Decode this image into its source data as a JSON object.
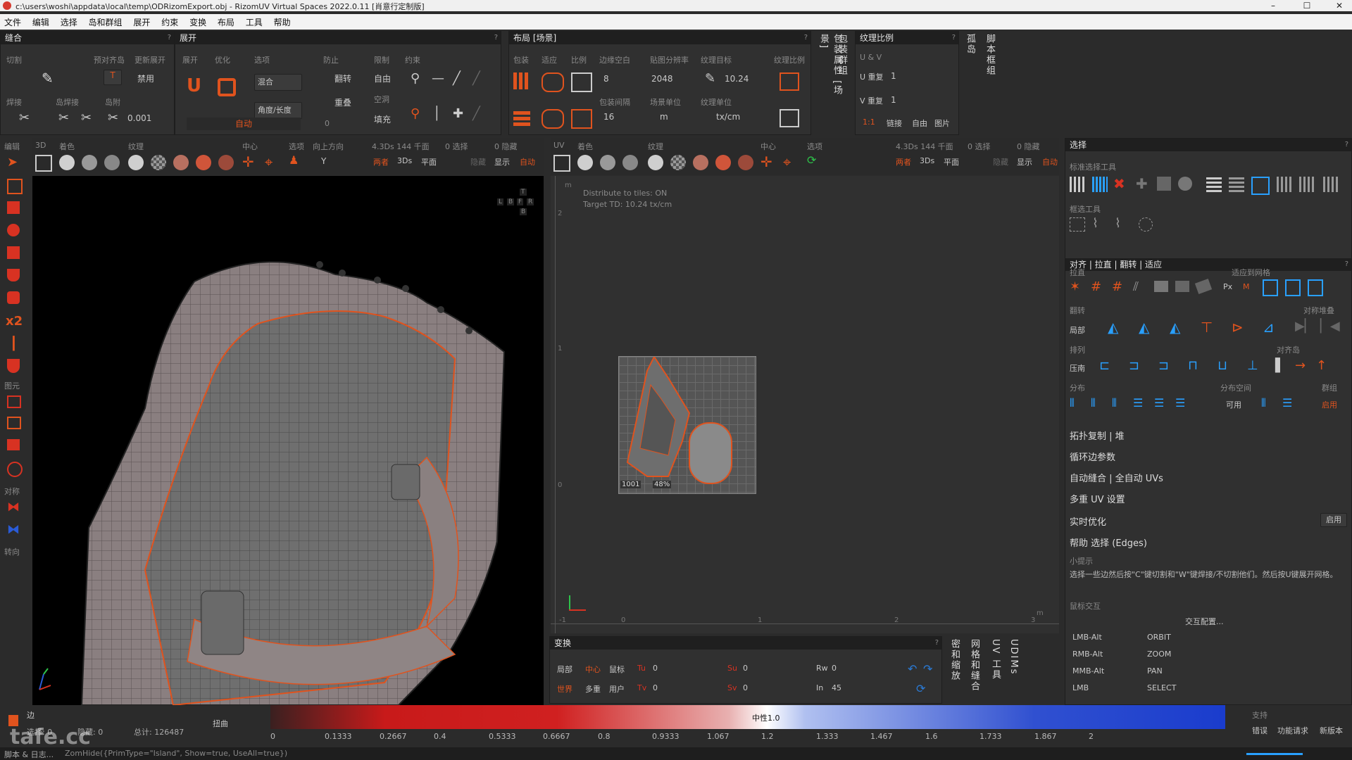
{
  "window": {
    "title": "c:\\users\\woshi\\appdata\\local\\temp\\ODRizomExport.obj - RizomUV Virtual Spaces 2022.0.11 [肖意行定制版]",
    "min": "–",
    "max": "☐",
    "close": "✕"
  },
  "menu": [
    "文件",
    "编辑",
    "选择",
    "岛和群组",
    "展开",
    "约束",
    "变换",
    "布局",
    "工具",
    "帮助"
  ],
  "seams": {
    "title": "缝合",
    "help": "?",
    "cut_label": "切割",
    "pre_align": "预对齐岛",
    "update_unfold": "更新展开",
    "weld_label": "焊接",
    "island_weld": "岛焊接",
    "auto_weld": "岛附",
    "t_val": "T",
    "disabled": "禁用",
    "num": "0.001"
  },
  "unfold": {
    "title": "展开",
    "help": "?",
    "unfold_label": "展开",
    "optimize": "优化",
    "options": "选项",
    "prevent": "防止",
    "limit": "限制",
    "constraint": "约束",
    "mix": "混合",
    "angle_len": "角度/长度",
    "flip": "翻转",
    "overlap": "重叠",
    "free": "自由",
    "fill": "填充",
    "empty": "空洞",
    "zero": "0",
    "auto": "自动"
  },
  "layout": {
    "title": "布局 [场景]",
    "help": "?",
    "pack": "包装",
    "fit": "适应",
    "scale": "比例",
    "margin": "边缘空白",
    "map_res": "贴图分辨率",
    "tex_target": "纹理目标",
    "tex_scale": "纹理比例",
    "pack_space": "包装间隔",
    "scene_unit": "场景单位",
    "tex_unit": "纹理单位",
    "margin_val": "8",
    "res_val": "2048",
    "tex_val": "10.24",
    "space_val": "16",
    "unit_val": "m",
    "texunit_val": "tx/cm"
  },
  "vertical_tabs": [
    "包装属性 [场景]",
    "包装群组",
    "孤岛",
    "脚本框组"
  ],
  "texscale": {
    "title": "纹理比例",
    "help": "?",
    "uv": "U & V",
    "u_rep": "U 重复",
    "u_val": "1",
    "v_rep": "V 重复",
    "v_val": "1",
    "one": "1:1",
    "link": "链接",
    "free": "自由",
    "image": "图片"
  },
  "left_tools": {
    "edit": "编辑",
    "x2": "x2",
    "prim": "图元",
    "sym": "对称",
    "axis": "转向"
  },
  "view3d_toolbar": {
    "label3d": "3D",
    "color": "着色",
    "texture": "纹理",
    "center": "中心",
    "options": "选项",
    "up": "向上方向",
    "stats": "4.3Ds 144 千面",
    "sel": "0 选择",
    "hidden": "0 隐藏",
    "up_val": "Y",
    "both": "两者",
    "mode3d": "3Ds",
    "flat": "平面",
    "hide": "隐藏",
    "show": "显示",
    "auto": "自动"
  },
  "uv_toolbar": {
    "label": "UV",
    "color": "着色",
    "texture": "纹理",
    "center": "中心",
    "options": "选项",
    "stats": "4.3Ds 144 千面",
    "sel": "0 选择",
    "hidden": "0 隐藏",
    "both": "两者",
    "mode3d": "3Ds",
    "flat": "平面",
    "hide": "隐藏",
    "show": "显示",
    "auto": "自动"
  },
  "view3d": {
    "nav": [
      "T",
      "L",
      "B",
      "F",
      "R",
      "B"
    ]
  },
  "uv_view": {
    "info1": "Distribute to tiles: ON",
    "info2": "Target TD: 10.24 tx/cm",
    "axis_m": "m",
    "y2": "2",
    "y1": "1",
    "y0": "0",
    "ym1": "-1",
    "x0": "0",
    "x1": "1",
    "x2": "2",
    "x3": "3",
    "xm": "m",
    "tile_label": "1001",
    "tile_pct": "48%"
  },
  "transform": {
    "title": "变换",
    "help": "?",
    "local": "局部",
    "center": "中心",
    "mouse": "鼠标",
    "world": "世界",
    "multi": "多重",
    "user": "用户",
    "tu": "Tu",
    "tu_val": "0",
    "tv": "Tv",
    "tv_val": "0",
    "su": "Su",
    "su_val": "0",
    "sv": "Sv",
    "sv_val": "0",
    "rw": "Rw",
    "rw_val": "0",
    "in": "In",
    "in_val": "45"
  },
  "vtabs2": [
    "密和缩放",
    "网格和缝合",
    "UV 工具",
    "UDIMs"
  ],
  "select_panel": {
    "title": "选择",
    "help": "?",
    "std_tools": "标准选择工具",
    "lasso_tools": "框选工具"
  },
  "align_panel": {
    "title": "对齐 | 拉直 | 翻转 | 适应",
    "help": "?",
    "straighten": "拉直",
    "fit_grid": "适应到网格",
    "px": "Px",
    "m": "M",
    "flip": "翻转",
    "local": "局部",
    "sym_stack": "对称堆叠",
    "arrange": "排列",
    "compress": "压南",
    "align_island": "对齐岛",
    "distribute": "分布",
    "dist_space": "分布空间",
    "avail": "可用",
    "group": "群组",
    "enable": "启用"
  },
  "sections": [
    "拓扑复制 | 堆",
    "循环边参数",
    "自动缝合 | 全自动 UVs",
    "多重 UV 设置"
  ],
  "realtime": {
    "label": "实时优化",
    "btn": "启用"
  },
  "help_panel": {
    "title": "帮助 选择 (Edges)",
    "tip_title": "小提示",
    "tip": "选择一些边然后按\"C\"键切割和\"W\"键焊接/不切割他们。然后按U键展开网格。",
    "mouse_title": "鼠标交互",
    "config": "交互配置...",
    "keys": [
      [
        "LMB-Alt",
        "ORBIT"
      ],
      [
        "RMB-Alt",
        "ZOOM"
      ],
      [
        "MMB-Alt",
        "PAN"
      ],
      [
        "LMB",
        "SELECT"
      ]
    ]
  },
  "statusbar": {
    "edge": "边",
    "selected": "选择: 0",
    "hidden": "隐藏: 0",
    "total": "总计: 126487",
    "distort": "扭曲",
    "neutral": "中性1.0",
    "ticks": [
      "0",
      "0.1333",
      "0.2667",
      "0.4",
      "0.5333",
      "0.6667",
      "0.8",
      "0.9333",
      "1.067",
      "1.2",
      "1.333",
      "1.467",
      "1.6",
      "1.733",
      "1.867",
      "2"
    ],
    "support": "支持",
    "errors": "错误",
    "feature": "功能请求",
    "news": "新版本",
    "script": "脚本 & 日志...",
    "cmd": "ZomHide({PrimType=\"Island\", Show=true, UseAll=true})",
    "watermark": "tafe.cc"
  },
  "colors": {
    "accent": "#e0531e",
    "red": "#d83222",
    "blue": "#2a5bd7"
  }
}
